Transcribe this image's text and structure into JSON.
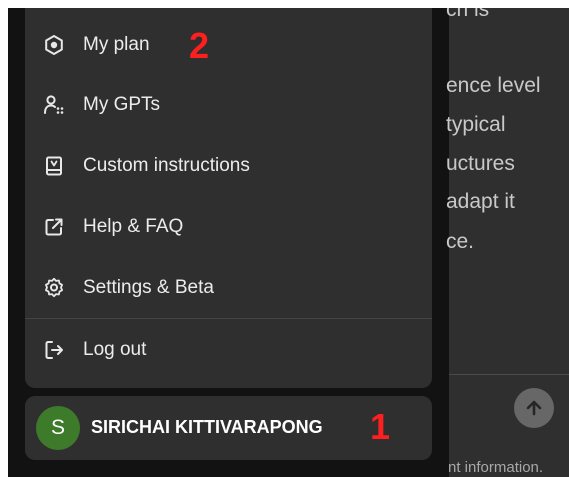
{
  "menu": {
    "items": [
      {
        "label": "My plan",
        "icon": "plan-icon"
      },
      {
        "label": "My GPTs",
        "icon": "gpts-icon"
      },
      {
        "label": "Custom instructions",
        "icon": "instructions-icon"
      },
      {
        "label": "Help & FAQ",
        "icon": "external-link-icon"
      },
      {
        "label": "Settings & Beta",
        "icon": "gear-icon"
      },
      {
        "label": "Log out",
        "icon": "logout-icon"
      }
    ]
  },
  "user": {
    "initial": "S",
    "name": "SIRICHAI KITTIVARAPONG",
    "avatar_color": "#3d7a2a"
  },
  "annotations": [
    "1",
    "2"
  ],
  "chat": {
    "lines": [
      "ch is",
      "ence level",
      "typical",
      "uctures",
      "adapt it",
      "ce."
    ],
    "footer": "nt information."
  },
  "colors": {
    "menu_bg": "#2f2f2f",
    "backdrop": "#121212",
    "annotation": "#ff1f1f"
  }
}
